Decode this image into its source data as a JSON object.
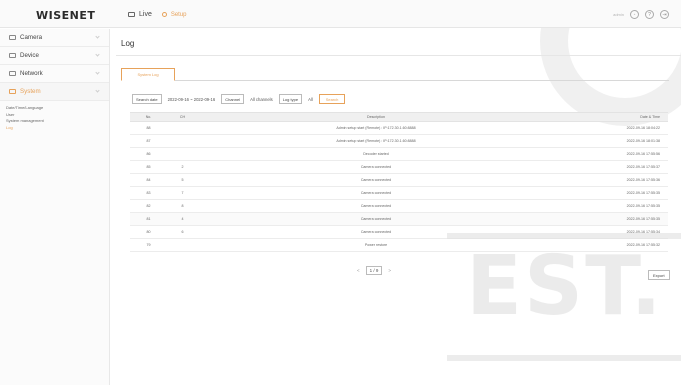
{
  "header": {
    "logo": "WISENET",
    "live_label": "Live",
    "setup_label": "Setup",
    "user_label": "admin",
    "icons": [
      "user-circle-icon",
      "help-icon",
      "logout-icon"
    ],
    "accent_color": "#e7a25a"
  },
  "sidebar": {
    "items": [
      {
        "label": "Camera",
        "icon": "camera-icon"
      },
      {
        "label": "Device",
        "icon": "device-icon"
      },
      {
        "label": "Network",
        "icon": "network-icon"
      },
      {
        "label": "System",
        "icon": "system-icon",
        "active": true
      }
    ],
    "submenu": [
      "Date/Time/Language",
      "User",
      "System management",
      "Log"
    ]
  },
  "main": {
    "title": "Log",
    "tab": "System Log",
    "filters": {
      "search_date_label": "Search date",
      "date_range": "2022-09-16 ~ 2022-09-16",
      "channel_label": "Channel",
      "channel_value": "All channels",
      "log_type_label": "Log type",
      "log_type_value": "All",
      "search_label": "Search"
    },
    "table": {
      "headers": [
        "No.",
        "CH",
        "Description",
        "Date & Time"
      ],
      "rows": [
        {
          "no": "88",
          "ch": "",
          "desc": "Admin setup start (Remote) : IP:172.30.1.60:8888",
          "dt": "2022-09-16 18:04:22"
        },
        {
          "no": "87",
          "ch": "",
          "desc": "Admin setup start (Remote) : IP:172.30.1.60:8888",
          "dt": "2022-09-16 18:01:38"
        },
        {
          "no": "86",
          "ch": "",
          "desc": "Decoder started",
          "dt": "2022-09-16 17:55:56"
        },
        {
          "no": "85",
          "ch": "2",
          "desc": "Camera connected",
          "dt": "2022-09-16 17:55:37"
        },
        {
          "no": "84",
          "ch": "5",
          "desc": "Camera connected",
          "dt": "2022-09-16 17:55:36"
        },
        {
          "no": "83",
          "ch": "7",
          "desc": "Camera connected",
          "dt": "2022-09-16 17:55:35"
        },
        {
          "no": "82",
          "ch": "8",
          "desc": "Camera connected",
          "dt": "2022-09-16 17:55:35"
        },
        {
          "no": "81",
          "ch": "4",
          "desc": "Camera connected",
          "dt": "2022-09-16 17:55:35"
        },
        {
          "no": "80",
          "ch": "6",
          "desc": "Camera connected",
          "dt": "2022-09-16 17:55:34"
        },
        {
          "no": "79",
          "ch": "",
          "desc": "Power restore",
          "dt": "2022-09-16 17:55:32"
        }
      ]
    },
    "pagination": {
      "prev": "<",
      "current": "1 / 9",
      "next": ">"
    },
    "export_label": "Export"
  },
  "watermark": {
    "text": "EST."
  }
}
